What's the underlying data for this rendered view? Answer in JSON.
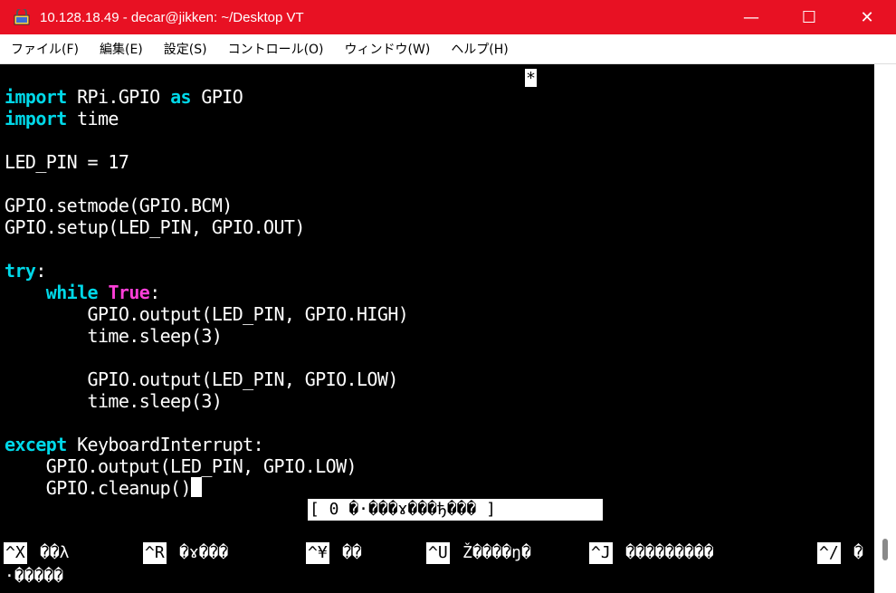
{
  "window": {
    "title": "10.128.18.49 - decar@jikken: ~/Desktop VT",
    "minimize_glyph": "—",
    "maximize_glyph": "☐",
    "close_glyph": "✕"
  },
  "menu": [
    "ファイル(F)",
    "編集(E)",
    "設定(S)",
    "コントロール(O)",
    "ウィンドウ(W)",
    "ヘルプ(H)"
  ],
  "editor": {
    "modified_flag": "*",
    "code": {
      "l1_kw": "import",
      "l1_rest": " RPi.GPIO ",
      "l1_kw2": "as",
      "l1_tail": " GPIO",
      "l2_kw": "import",
      "l2_rest": " time",
      "l4": "LED_PIN = 17",
      "l6": "GPIO.setmode(GPIO.BCM)",
      "l7": "GPIO.setup(LED_PIN, GPIO.OUT)",
      "l9_kw": "try",
      "l9_rest": ":",
      "l10_indent": "    ",
      "l10_kw": "while",
      "l10_sp": " ",
      "l10_kw2": "True",
      "l10_rest": ":",
      "l11": "        GPIO.output(LED_PIN, GPIO.HIGH)",
      "l12": "        time.sleep(3)",
      "l14": "        GPIO.output(LED_PIN, GPIO.LOW)",
      "l15": "        time.sleep(3)",
      "l17_kw": "except",
      "l17_rest": " KeyboardInterrupt:",
      "l18": "    GPIO.output(LED_PIN, GPIO.LOW)",
      "l19": "    GPIO.cleanup()"
    },
    "status_message": "[ 0 �·���ɤ���ђ��� ]",
    "help": [
      {
        "key": "^X",
        "label": "��λ"
      },
      {
        "key": "^R",
        "label": "�ɤ���"
      },
      {
        "key": "^¥",
        "label": "��"
      },
      {
        "key": "^U",
        "label": "Ž����ŋ�"
      },
      {
        "key": "^J",
        "label": "���������"
      },
      {
        "key": "^/",
        "label": "�"
      }
    ],
    "help_line2": "·�����"
  }
}
